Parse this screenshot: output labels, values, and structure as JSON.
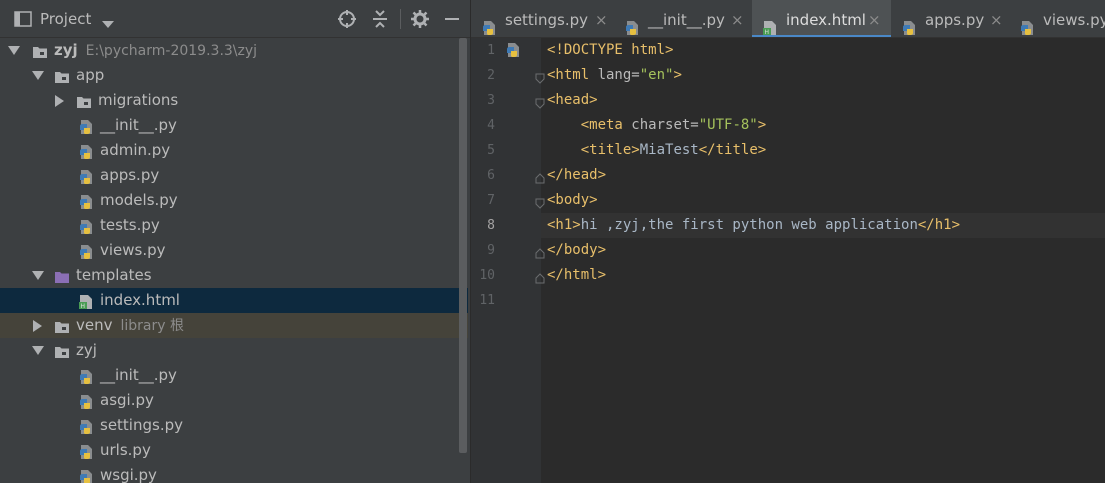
{
  "project_panel": {
    "title": "Project",
    "tree": [
      {
        "label": "zyj",
        "sub": "E:\\pycharm-2019.3.3\\zyj",
        "level": 0,
        "expanded": true,
        "icon": "folder-icon"
      },
      {
        "label": "app",
        "level": 1,
        "expanded": true,
        "icon": "folder-icon"
      },
      {
        "label": "migrations",
        "level": 2,
        "expanded": false,
        "icon": "folder-icon"
      },
      {
        "label": "__init__.py",
        "level": 3,
        "icon": "python-file-icon"
      },
      {
        "label": "admin.py",
        "level": 3,
        "icon": "python-file-icon"
      },
      {
        "label": "apps.py",
        "level": 3,
        "icon": "python-file-icon"
      },
      {
        "label": "models.py",
        "level": 3,
        "icon": "python-file-icon"
      },
      {
        "label": "tests.py",
        "level": 3,
        "icon": "python-file-icon"
      },
      {
        "label": "views.py",
        "level": 3,
        "icon": "python-file-icon"
      },
      {
        "label": "templates",
        "level": 1,
        "expanded": true,
        "icon": "templates-folder-icon"
      },
      {
        "label": "index.html",
        "level": 3,
        "icon": "html-file-icon",
        "selected": true
      },
      {
        "label": "venv",
        "sub": "library 根",
        "level": 1,
        "expanded": false,
        "icon": "folder-icon",
        "excluded": true
      },
      {
        "label": "zyj",
        "level": 1,
        "expanded": true,
        "icon": "folder-icon"
      },
      {
        "label": "__init__.py",
        "level": 3,
        "icon": "python-file-icon"
      },
      {
        "label": "asgi.py",
        "level": 3,
        "icon": "python-file-icon"
      },
      {
        "label": "settings.py",
        "level": 3,
        "icon": "python-file-icon"
      },
      {
        "label": "urls.py",
        "level": 3,
        "icon": "python-file-icon"
      },
      {
        "label": "wsgi.py",
        "level": 3,
        "icon": "python-file-icon"
      }
    ]
  },
  "tabs": [
    {
      "label": "settings.py",
      "icon": "python-file-icon",
      "active": false
    },
    {
      "label": "__init__.py",
      "icon": "python-file-icon",
      "active": false
    },
    {
      "label": "index.html",
      "icon": "html-file-icon",
      "active": true
    },
    {
      "label": "apps.py",
      "icon": "python-file-icon",
      "active": false
    },
    {
      "label": "views.py",
      "icon": "python-file-icon",
      "active": false
    }
  ],
  "editor": {
    "current_line": 8,
    "line_numbers": [
      "1",
      "2",
      "3",
      "4",
      "5",
      "6",
      "7",
      "8",
      "9",
      "10",
      "11"
    ],
    "lines": [
      [
        {
          "t": "tg",
          "v": "<!DOCTYPE html>"
        }
      ],
      [
        {
          "t": "tg",
          "v": "<html "
        },
        {
          "t": "at",
          "v": "lang="
        },
        {
          "t": "av",
          "v": "\"en\""
        },
        {
          "t": "tg",
          "v": ">"
        }
      ],
      [
        {
          "t": "tg",
          "v": "<head>"
        }
      ],
      [
        {
          "t": "tx",
          "v": "    "
        },
        {
          "t": "tg",
          "v": "<meta "
        },
        {
          "t": "at",
          "v": "charset="
        },
        {
          "t": "av",
          "v": "\"UTF-8\""
        },
        {
          "t": "tg",
          "v": ">"
        }
      ],
      [
        {
          "t": "tx",
          "v": "    "
        },
        {
          "t": "tg",
          "v": "<title>"
        },
        {
          "t": "tx",
          "v": "MiaTest"
        },
        {
          "t": "tg",
          "v": "</title>"
        }
      ],
      [
        {
          "t": "tg",
          "v": "</head>"
        }
      ],
      [
        {
          "t": "tg",
          "v": "<body>"
        }
      ],
      [
        {
          "t": "tg",
          "v": "<h1>"
        },
        {
          "t": "tx",
          "v": "hi ,zyj,the first python web application"
        },
        {
          "t": "tg",
          "v": "</h1>"
        }
      ],
      [
        {
          "t": "tg",
          "v": "</body>"
        }
      ],
      [
        {
          "t": "tg",
          "v": "</html>"
        }
      ],
      []
    ]
  },
  "colors": {
    "panel_bg": "#3c3f41",
    "editor_bg": "#2b2b2b",
    "selection": "#0d293e",
    "tag": "#e8bf6a",
    "attr_value": "#a5c25c",
    "active_tab_underline": "#4a88c7"
  }
}
